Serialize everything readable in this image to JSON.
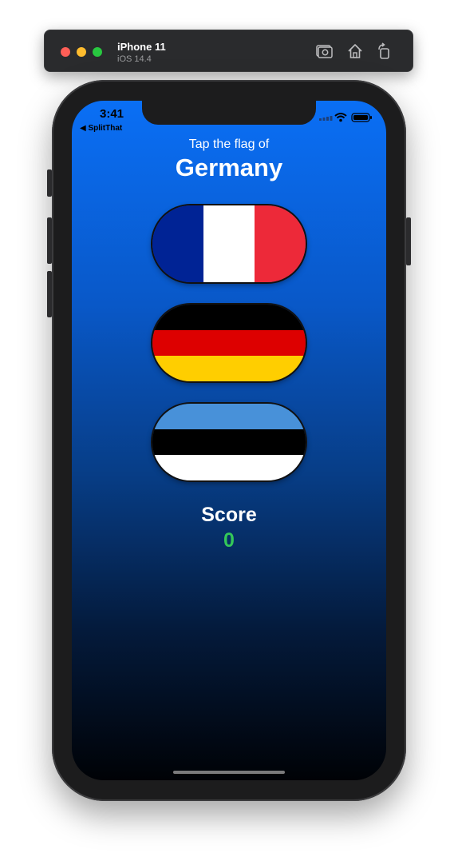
{
  "simulator": {
    "device_name": "iPhone 11",
    "os_version": "iOS 14.4",
    "toolbar_icons": [
      "screenshot-icon",
      "home-icon",
      "rotate-icon"
    ],
    "traffic_colors": {
      "close": "#ff5f57",
      "minimize": "#febc2e",
      "zoom": "#28c840"
    }
  },
  "status_bar": {
    "time": "3:41",
    "back_label": "◀ SplitThat",
    "icons": [
      "signal-icon",
      "wifi-icon",
      "battery-icon"
    ]
  },
  "game": {
    "prompt": "Tap the flag of",
    "country": "Germany",
    "flags": [
      {
        "country": "France",
        "orientation": "vertical",
        "colors": [
          "#002395",
          "#ffffff",
          "#ed2939"
        ]
      },
      {
        "country": "Germany",
        "orientation": "horizontal",
        "colors": [
          "#000000",
          "#dd0000",
          "#ffce00"
        ]
      },
      {
        "country": "Estonia",
        "orientation": "horizontal",
        "colors": [
          "#4891d9",
          "#000000",
          "#ffffff"
        ]
      }
    ],
    "score_label": "Score",
    "score_value": "0",
    "score_color": "#34c759"
  }
}
